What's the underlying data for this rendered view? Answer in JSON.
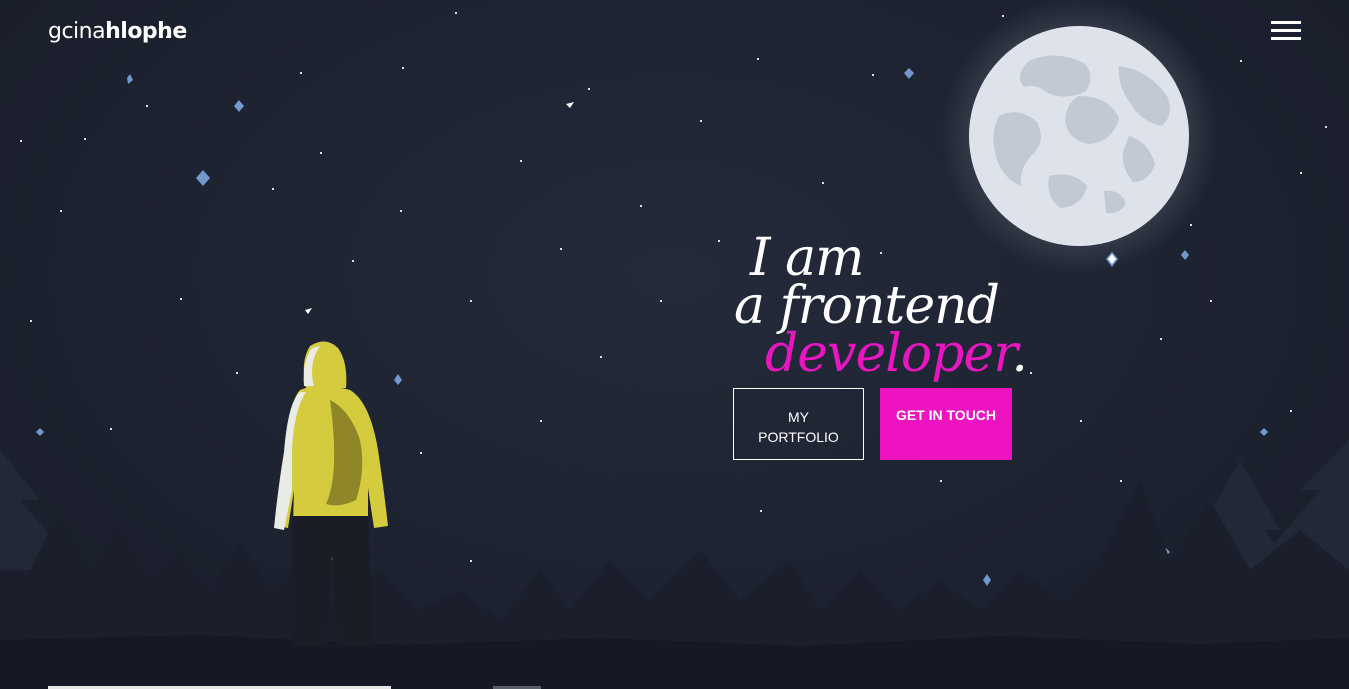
{
  "header": {
    "logo_thin": "gcina",
    "logo_bold": "hlophe",
    "menu_icon": "hamburger-menu-icon"
  },
  "hero": {
    "line1": "I am",
    "line2": "a frontend",
    "line3_accent": "developer",
    "line3_dot": "."
  },
  "buttons": {
    "portfolio_line1": "MY",
    "portfolio_line2": "PORTFOLIO",
    "contact": "GET IN TOUCH"
  },
  "colors": {
    "background": "#1d2230",
    "accent": "#ee13c1",
    "hoodie": "#d4cb3e",
    "moon": "#dde2eb"
  }
}
